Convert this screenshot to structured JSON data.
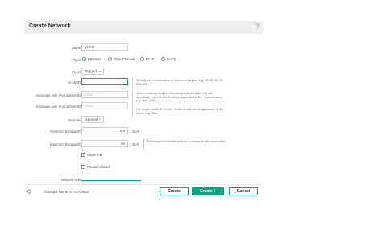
{
  "dialog": {
    "title": "Create Network",
    "help_glyph": "?"
  },
  "form": {
    "name_label": "Name",
    "name_value": "VLAN",
    "type_label": "Type",
    "type_options": [
      "Ethernet",
      "Fibre Channel",
      "FCoE",
      "RoCE"
    ],
    "type_selected": "Ethernet",
    "vlan_label": "VLAN",
    "vlan_value": "Tagged",
    "vlan_id_label": "VLAN ID",
    "vlan_id_value": "",
    "vlan_id_help": "Specify as a combination of values or ranges, e.g. 10-15, 50, 52, 300-350.",
    "ipv4_label": "Associate with IPv4 subnet ID",
    "ipv4_placeholder": "none",
    "ipv6_label": "Associate with IPv6 subnet ID",
    "ipv6_placeholder": "none",
    "multi_help_1": "When creating multiple networks (multiple VLAN IDs are specified), each VLAN ID will be appended to the network name, e.g. fiber_100.",
    "multi_help_2": "For single VLAN ID entries, VLAN ID will not be appended to the name, e.g. fiber.",
    "purpose_label": "Purpose",
    "purpose_value": "General",
    "preferred_bw_label": "Preferred bandwidth",
    "preferred_bw_value": "2.5",
    "preferred_bw_unit": "Gb/s",
    "max_bw_label": "Maximum bandwidth",
    "max_bw_value": "50",
    "max_bw_unit": "Gb/s",
    "max_bw_help": "Maximum bandwidth value for a server profile connection",
    "smart_link_label": "Smart link",
    "smart_link_checked": true,
    "private_network_label": "Private network",
    "private_network_checked": false,
    "network_sets_label": "Network sets"
  },
  "footer": {
    "status_text": "Changed Name to \"VLAN560\"",
    "create_label": "Create",
    "create_plus_label": "Create +",
    "cancel_label": "Cancel"
  },
  "colors": {
    "accent": "#01a982",
    "header_bg": "#eeeeee"
  }
}
